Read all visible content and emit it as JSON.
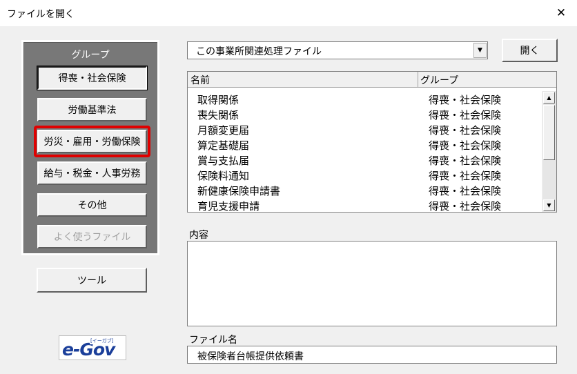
{
  "window": {
    "title": "ファイルを開く",
    "close_glyph": "✕"
  },
  "group_panel": {
    "title": "グループ",
    "buttons": [
      {
        "label": "得喪・社会保険"
      },
      {
        "label": "労働基準法"
      },
      {
        "label": "労災・雇用・労働保険"
      },
      {
        "label": "給与・税金・人事労務"
      },
      {
        "label": "その他"
      },
      {
        "label": "よく使うファイル"
      }
    ]
  },
  "tool_button": {
    "label": "ツール"
  },
  "logo": {
    "text": "e-Gov",
    "sub": "[イーガブ]"
  },
  "combo": {
    "selected": "この事業所関連処理ファイル",
    "arrow": "▼"
  },
  "open_button": {
    "label": "開く"
  },
  "list": {
    "headers": {
      "name": "名前",
      "group": "グループ"
    },
    "rows": [
      {
        "name": "取得関係",
        "group": "得喪・社会保険"
      },
      {
        "name": "喪失関係",
        "group": "得喪・社会保険"
      },
      {
        "name": "月額変更届",
        "group": "得喪・社会保険"
      },
      {
        "name": "算定基礎届",
        "group": "得喪・社会保険"
      },
      {
        "name": "賞与支払届",
        "group": "得喪・社会保険"
      },
      {
        "name": "保険料通知",
        "group": "得喪・社会保険"
      },
      {
        "name": "新健康保険申請書",
        "group": "得喪・社会保険"
      },
      {
        "name": "育児支援申請",
        "group": "得喪・社会保険"
      }
    ],
    "scroll_up": "▲",
    "scroll_down": "▼"
  },
  "content": {
    "label": "内容"
  },
  "file_name": {
    "label": "ファイル名",
    "value": "被保険者台帳提供依頼書"
  },
  "colors": {
    "panel_bg": "#787878",
    "highlight": "#e00000",
    "logo": "#1b3f9a"
  }
}
